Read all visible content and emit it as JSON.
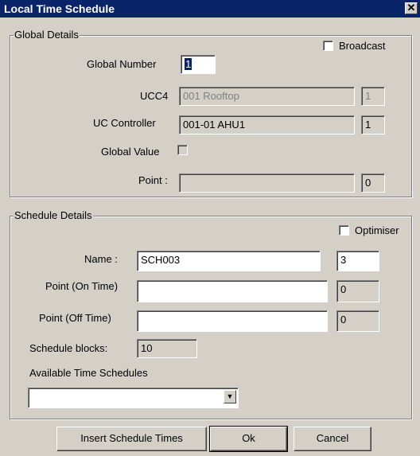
{
  "window": {
    "title": "Local Time Schedule",
    "close_glyph": "✕"
  },
  "global": {
    "group_title": "Global Details",
    "broadcast_label": "Broadcast",
    "broadcast_checked": false,
    "global_number_label": "Global Number",
    "global_number_value": "1",
    "ucc4_label": "UCC4",
    "ucc4_value": "001 Rooftop",
    "ucc4_num": "1",
    "uc_controller_label": "UC Controller",
    "uc_controller_value": "001-01 AHU1",
    "uc_controller_num": "1",
    "global_value_label": "Global Value",
    "global_value_checked": false,
    "point_label": "Point :",
    "point_value": "",
    "point_num": "0"
  },
  "schedule": {
    "group_title": "Schedule Details",
    "optimiser_label": "Optimiser",
    "optimiser_checked": false,
    "name_label": "Name :",
    "name_value": "SCH003",
    "name_num": "3",
    "point_on_label": "Point  (On Time)",
    "point_on_value": "",
    "point_on_num": "0",
    "point_off_label": "Point (Off Time)",
    "point_off_value": "",
    "point_off_num": "0",
    "blocks_label": "Schedule blocks:",
    "blocks_value": "10",
    "available_label": "Available Time Schedules",
    "available_selected": ""
  },
  "buttons": {
    "insert": "Insert Schedule Times",
    "ok": "Ok",
    "cancel": "Cancel"
  },
  "icons": {
    "dropdown": "chevron-down-icon",
    "close": "close-icon"
  }
}
